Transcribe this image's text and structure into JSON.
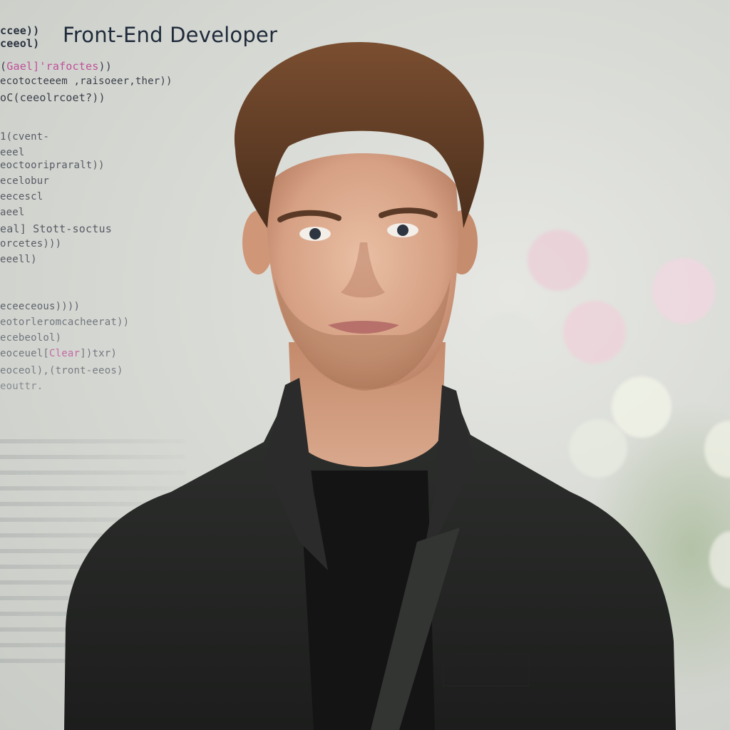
{
  "header": {
    "title": "Front-End Developer"
  },
  "code_overlay": {
    "lines": [
      {
        "text": "ccee))",
        "color": "#2b3340"
      },
      {
        "text": "ceeol)",
        "color": "#2b3340"
      },
      {
        "text": "(Gael]'rafoctes))",
        "color": "#3b3f4a"
      },
      {
        "text": "ecotocteeem ,raisoeer,ther))",
        "color": "#3b3f4a"
      },
      {
        "text": "oC(ceeolrcoet?))",
        "color": "#3b3f4a"
      },
      {
        "text": "1(cvent-",
        "color": "#4a4f5a"
      },
      {
        "text": "eeel",
        "color": "#4a4f5a"
      },
      {
        "text": "eoctooripraralt))",
        "color": "#4a4f5a"
      },
      {
        "text": "ecelobur",
        "color": "#4a4f5a"
      },
      {
        "text": "eecescl",
        "color": "#4a4f5a"
      },
      {
        "text": "aeel",
        "color": "#4a4f5a"
      },
      {
        "text": "eal] Stott-soctus",
        "color": "#4a4f5a"
      },
      {
        "text": "orcetes)))",
        "color": "#4a4f5a"
      },
      {
        "text": "eeell)",
        "color": "#4a4f5a"
      },
      {
        "text": "eceeceous))))",
        "color": "#4a4f5a"
      },
      {
        "text": "eotorleromcacheerat))",
        "color": "#5a5f6a"
      },
      {
        "text": "ecebeolol)",
        "color": "#5a5f6a"
      },
      {
        "text": "eoceuel[Clear])txr)",
        "color": "#5a5f6a"
      },
      {
        "text": "eoceol),(tront-eeos)",
        "color": "#5a5f6a"
      },
      {
        "text": "eouttr.",
        "color": "#6a6f7a"
      }
    ],
    "accent_color": "#c0509a"
  }
}
